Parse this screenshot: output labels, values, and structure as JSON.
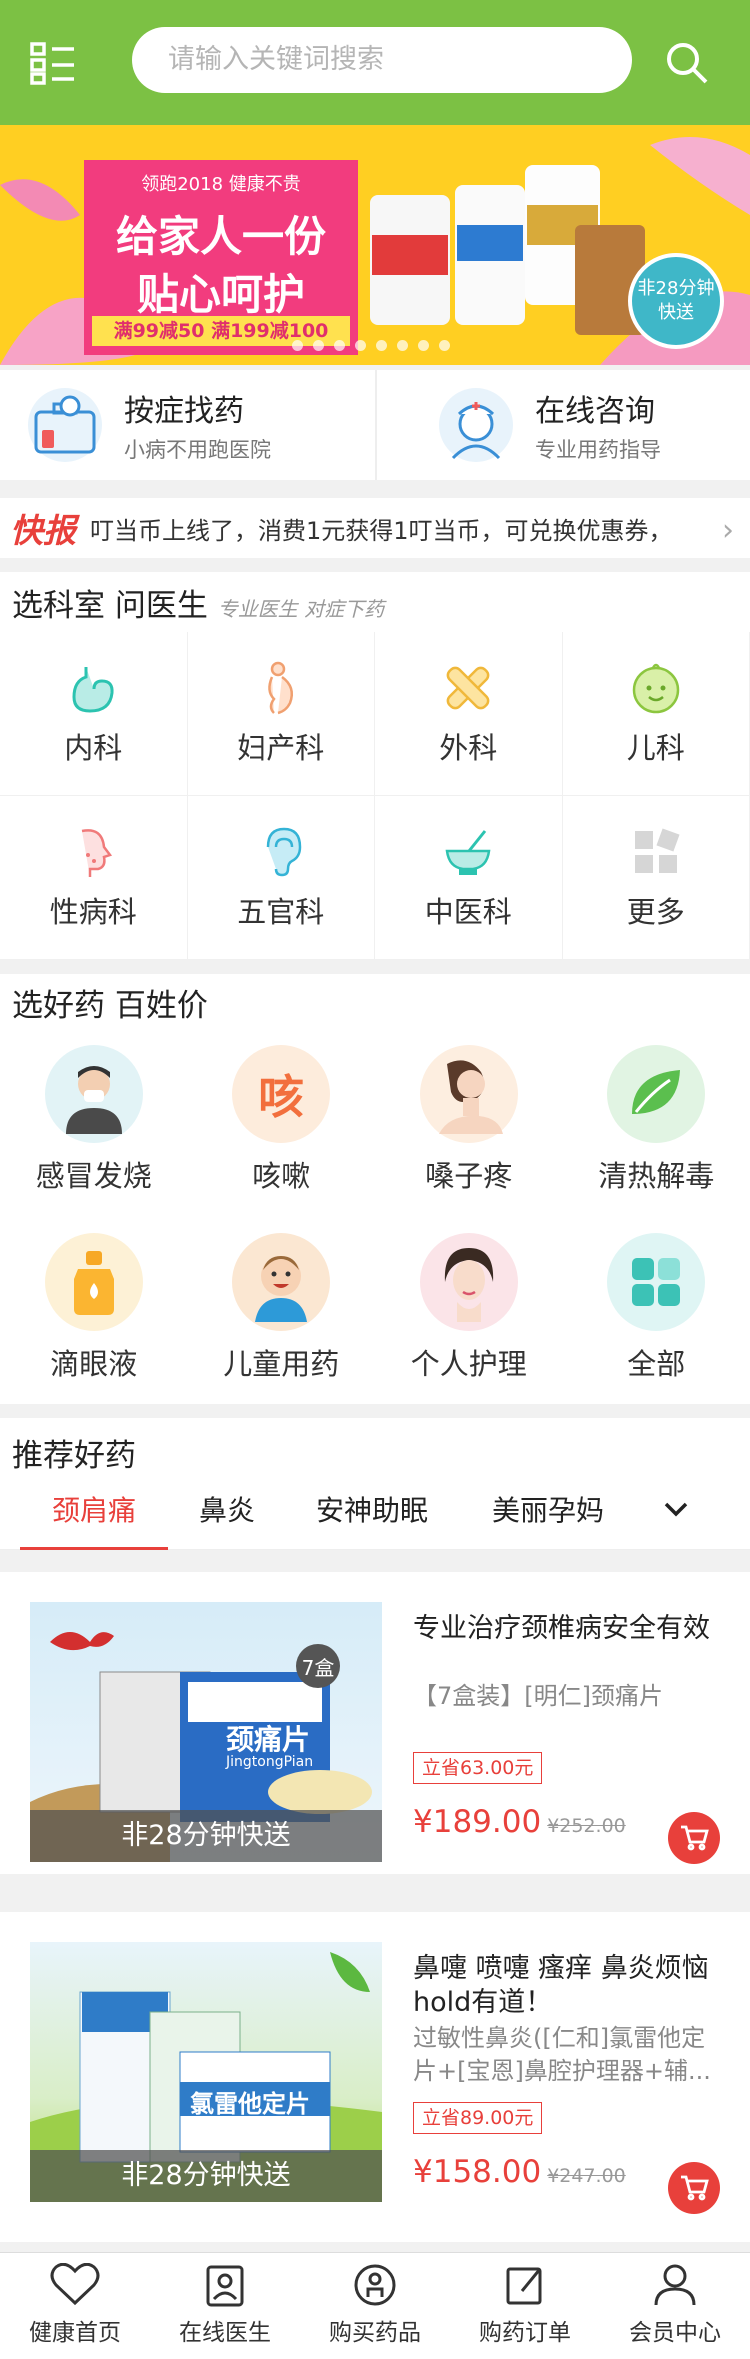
{
  "header": {
    "search_placeholder": "请输入关键词搜索"
  },
  "banner": {
    "line1": "领跑2018  健康不贵",
    "line2a": "给家人一份",
    "line2b": "贴心呵护",
    "promo": "满99减50  满199减100",
    "badge_line1": "非28分钟",
    "badge_line2": "快送",
    "colors": {
      "bg": "#ffcf22",
      "pink": "#f23c7e"
    }
  },
  "quick": [
    {
      "title": "按症找药",
      "sub": "小病不用跑医院"
    },
    {
      "title": "在线咨询",
      "sub": "专业用药指导"
    }
  ],
  "news": {
    "tag": "快报",
    "text": "叮当币上线了，消费1元获得1叮当币，可兑换优惠券，"
  },
  "dept": {
    "title": "选科室  问医生",
    "slogan": "专业医生 对症下药",
    "items": [
      {
        "label": "内科",
        "icon": "stomach-icon"
      },
      {
        "label": "妇产科",
        "icon": "pregnant-icon"
      },
      {
        "label": "外科",
        "icon": "bandage-icon"
      },
      {
        "label": "儿科",
        "icon": "baby-face-icon"
      },
      {
        "label": "性病科",
        "icon": "face-profile-icon"
      },
      {
        "label": "五官科",
        "icon": "ear-icon"
      },
      {
        "label": "中医科",
        "icon": "mortar-icon"
      },
      {
        "label": "更多",
        "icon": "more-grid-icon"
      }
    ]
  },
  "drugs": {
    "title": "选好药  百姓价",
    "items": [
      {
        "label": "感冒发烧",
        "icon": "cold-man-icon"
      },
      {
        "label": "咳嗽",
        "icon": "cough-icon",
        "glyph": "咳"
      },
      {
        "label": "嗓子疼",
        "icon": "throat-icon"
      },
      {
        "label": "清热解毒",
        "icon": "leaf-icon"
      },
      {
        "label": "滴眼液",
        "icon": "eye-drop-icon"
      },
      {
        "label": "儿童用药",
        "icon": "child-icon"
      },
      {
        "label": "个人护理",
        "icon": "woman-face-icon"
      },
      {
        "label": "全部",
        "icon": "all-grid-icon"
      }
    ]
  },
  "recommend": {
    "title": "推荐好药",
    "tabs": [
      "颈肩痛",
      "鼻炎",
      "安神助眠",
      "美丽孕妈"
    ]
  },
  "products": [
    {
      "caption": "非28分钟快送",
      "box_label": "7盒",
      "title": "专业治疗颈椎病安全有效",
      "desc": "【7盒装】[明仁]颈痛片",
      "save": "立省63.00元",
      "price": "¥189.00",
      "old_price": "¥252.00",
      "pack_name": "颈痛片",
      "pack_sub": "JingtongPian"
    },
    {
      "caption": "非28分钟快送",
      "title": "鼻嚏 喷嚏 瘙痒 鼻炎烦恼hold有道！",
      "desc": "过敏性鼻炎([仁和]氯雷他定片+[宝恩]鼻腔护理器+辅...",
      "save": "立省89.00元",
      "price": "¥158.00",
      "old_price": "¥247.00",
      "pack_name": "氯雷他定片"
    }
  ],
  "nav": [
    "健康首页",
    "在线医生",
    "购买药品",
    "购药订单",
    "会员中心"
  ]
}
